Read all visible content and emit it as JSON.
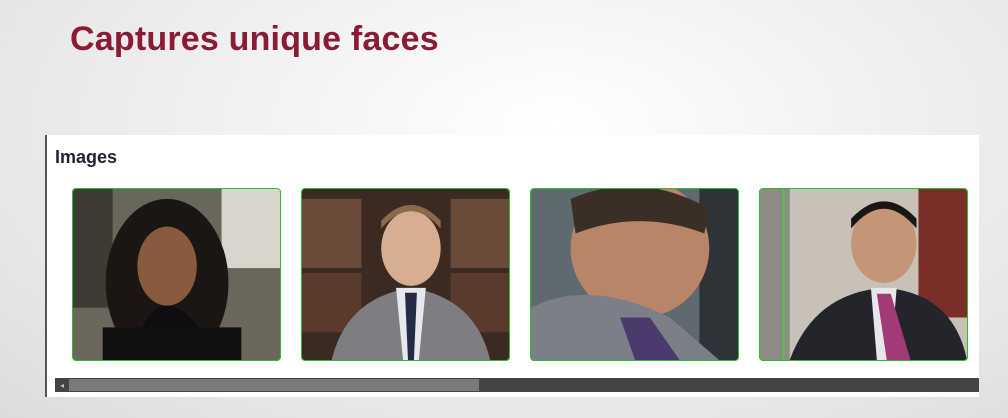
{
  "slide": {
    "title": "Captures unique faces"
  },
  "panel": {
    "heading": "Images",
    "images": [
      {
        "name": "face-1"
      },
      {
        "name": "face-2"
      },
      {
        "name": "face-3"
      },
      {
        "name": "face-4"
      }
    ]
  },
  "scrollbar": {
    "left_arrow_icon": "◂",
    "position_fraction": 0
  },
  "colors": {
    "title": "#8b1a33",
    "thumb_border": "#22c322",
    "scrollbar_track": "#444444"
  }
}
